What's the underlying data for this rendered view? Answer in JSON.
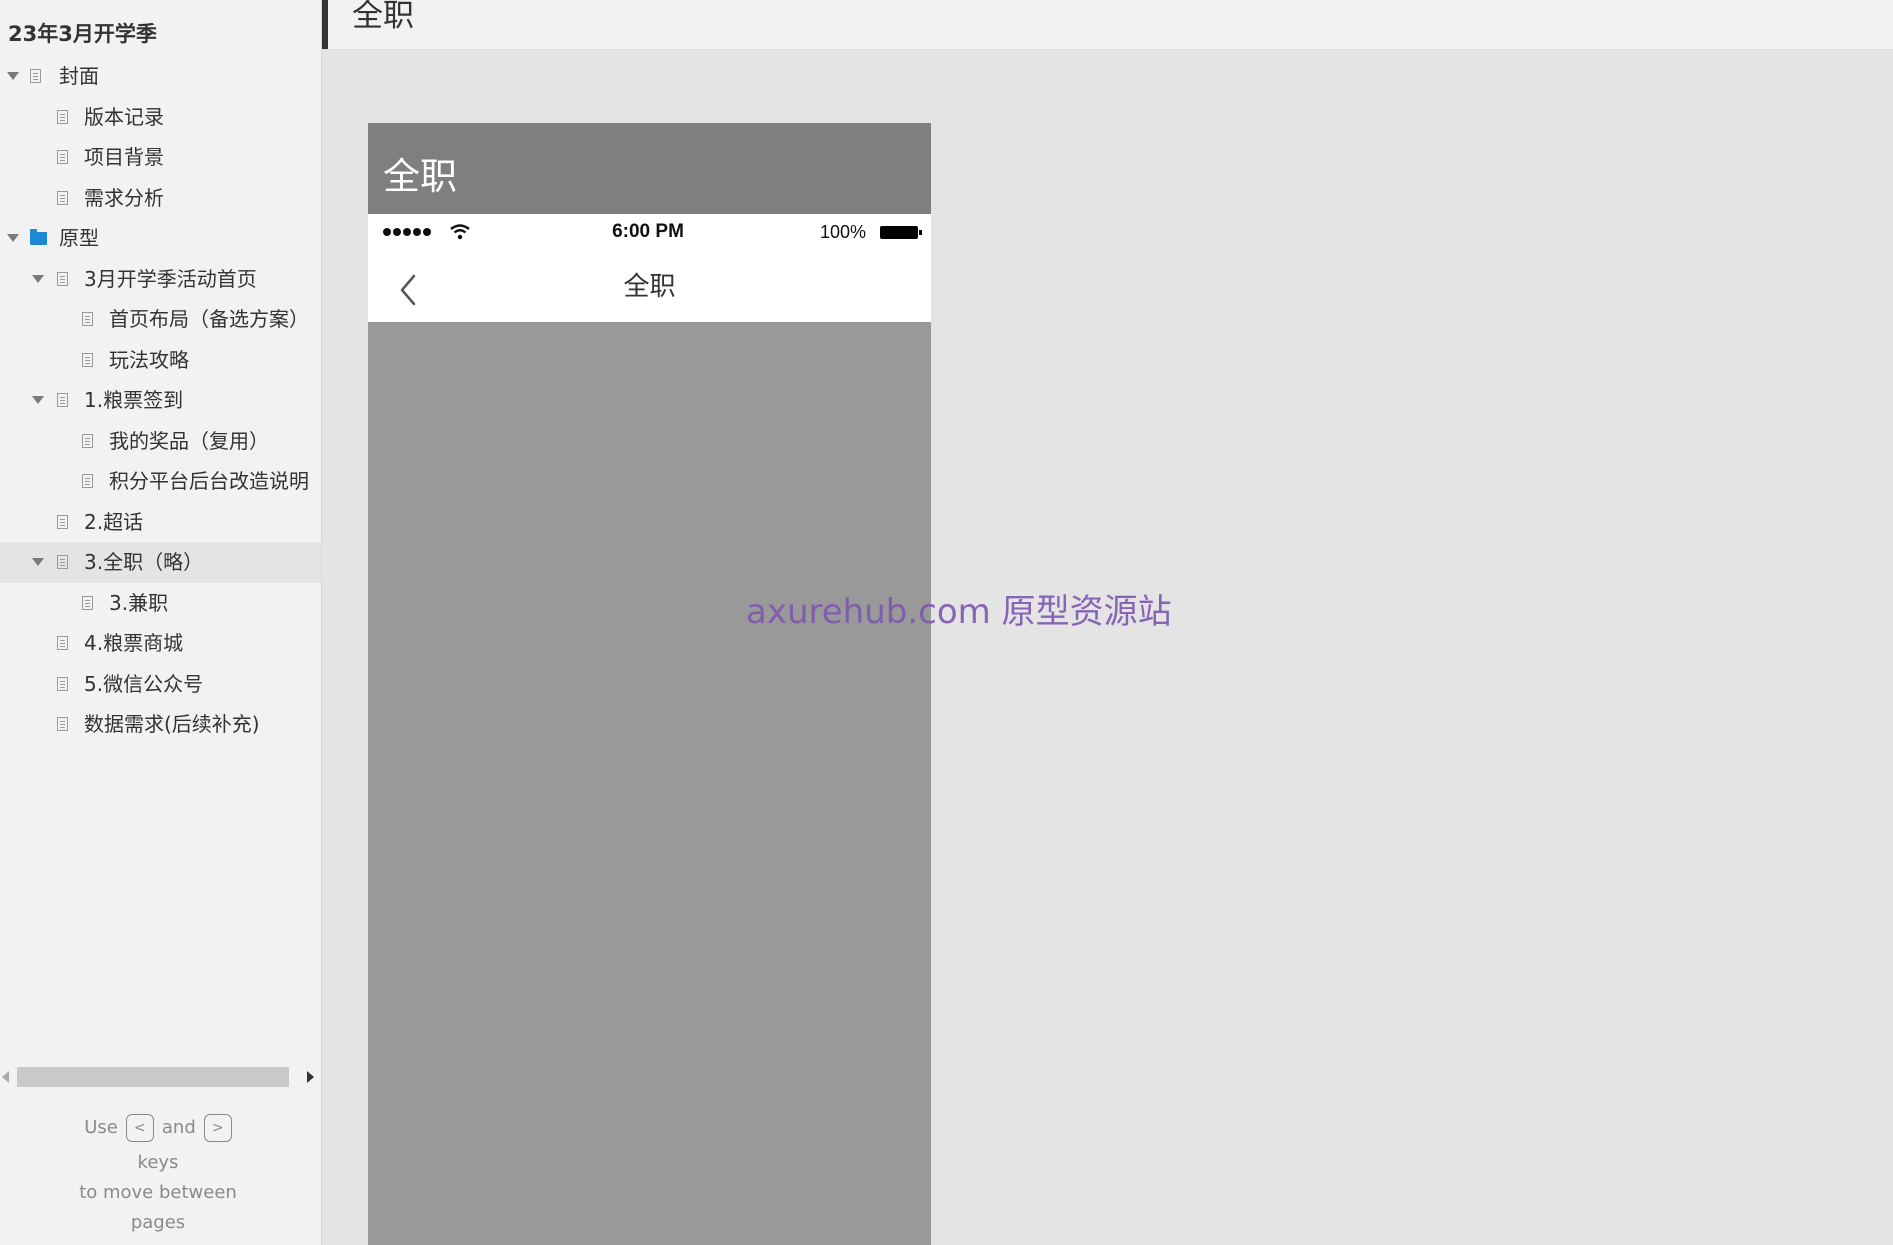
{
  "sidebar": {
    "project_title": "23年3月开学季",
    "tree": [
      {
        "label": "封面",
        "depth": 0,
        "expanded": true,
        "type": "page"
      },
      {
        "label": "版本记录",
        "depth": 1,
        "type": "page"
      },
      {
        "label": "项目背景",
        "depth": 1,
        "type": "page"
      },
      {
        "label": "需求分析",
        "depth": 1,
        "type": "page"
      },
      {
        "label": "原型",
        "depth": 0,
        "expanded": true,
        "type": "folder"
      },
      {
        "label": "3月开学季活动首页",
        "depth": 1,
        "expanded": true,
        "type": "page"
      },
      {
        "label": "首页布局（备选方案）",
        "depth": 2,
        "type": "page"
      },
      {
        "label": "玩法攻略",
        "depth": 2,
        "type": "page"
      },
      {
        "label": "1.粮票签到",
        "depth": 1,
        "expanded": true,
        "type": "page"
      },
      {
        "label": "我的奖品（复用）",
        "depth": 2,
        "type": "page"
      },
      {
        "label": "积分平台后台改造说明",
        "depth": 2,
        "type": "page"
      },
      {
        "label": "2.超话",
        "depth": 1,
        "type": "page"
      },
      {
        "label": "3.全职（略）",
        "depth": 1,
        "expanded": true,
        "type": "page",
        "selected": true
      },
      {
        "label": "3.兼职",
        "depth": 2,
        "type": "page"
      },
      {
        "label": "4.粮票商城",
        "depth": 1,
        "type": "page"
      },
      {
        "label": "5.微信公众号",
        "depth": 1,
        "type": "page"
      },
      {
        "label": "数据需求(后续补充)",
        "depth": 1,
        "type": "page"
      }
    ],
    "hint": {
      "use": "Use",
      "prev_key": "<",
      "and": "and",
      "next_key": ">",
      "keys": "keys",
      "to_move": "to move between",
      "pages": "pages"
    }
  },
  "topbar": {
    "title": "全职"
  },
  "mobile": {
    "header_title": "全职",
    "status": {
      "time": "6:00 PM",
      "battery": "100%"
    },
    "nav_title": "全职"
  },
  "watermark": "axurehub.com 原型资源站",
  "colors": {
    "sidebar_bg": "#f2f2f2",
    "canvas_bg": "#e4e4e4",
    "folder_icon": "#1e88d6",
    "mobile_header_bg": "#7f7f7f",
    "mobile_body_bg": "#999999",
    "watermark": "#7e57b0"
  }
}
